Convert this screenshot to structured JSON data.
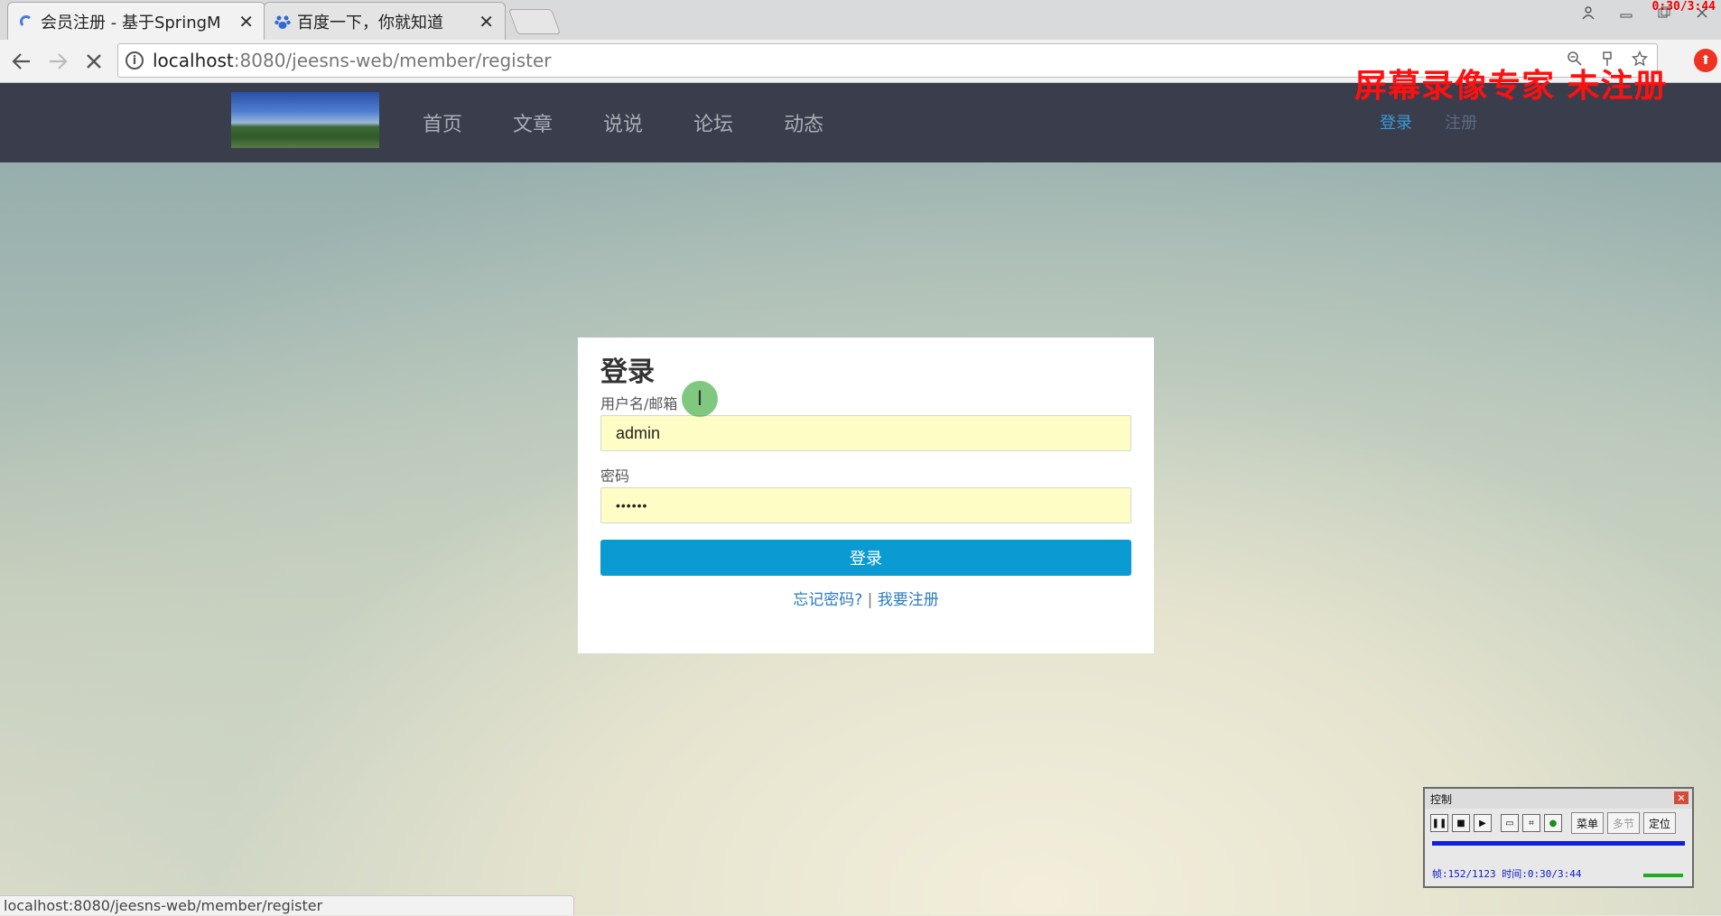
{
  "browser": {
    "tabs": [
      {
        "title": "会员注册 - 基于SpringM",
        "close": "✕",
        "active": true
      },
      {
        "title": "百度一下，你就知道",
        "close": "✕",
        "active": false
      }
    ],
    "url_host": "localhost",
    "url_rest": ":8080/jeesns-web/member/register",
    "status_url": "localhost:8080/jeesns-web/member/register",
    "recording_time": "0:30/3:44"
  },
  "navbar": {
    "items": [
      "首页",
      "文章",
      "说说",
      "论坛",
      "动态"
    ],
    "login": "登录",
    "register": "注册"
  },
  "watermark": "屏幕录像专家  未注册",
  "login_form": {
    "title": "登录",
    "username_label": "用户名/邮箱",
    "username_value": "admin",
    "password_label": "密码",
    "password_value": "••••••",
    "submit": "登录",
    "forgot": "忘记密码?",
    "separator": "|",
    "register": "我要注册"
  },
  "recorder": {
    "title": "控制",
    "menu": "菜单",
    "multi": "多节",
    "locate": "定位",
    "info": "帧:152/1123 时间:0:30/3:44"
  }
}
